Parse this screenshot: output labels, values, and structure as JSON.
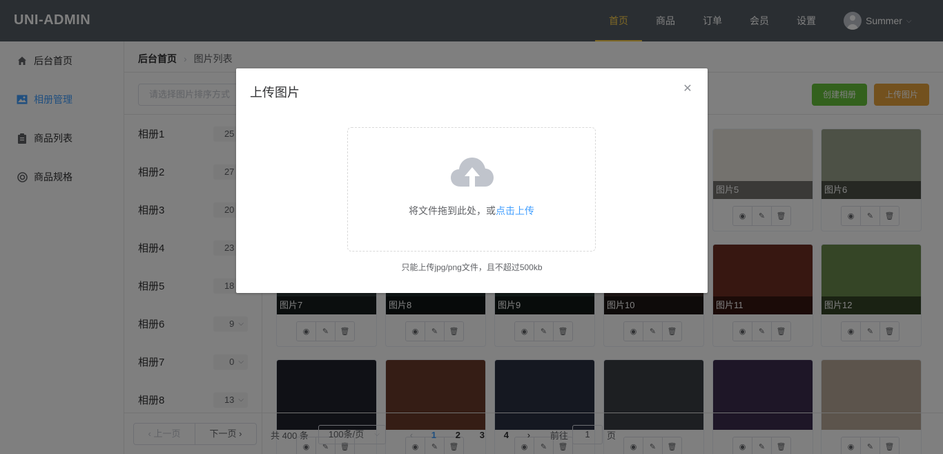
{
  "app": {
    "logo": "UNI-ADMIN"
  },
  "topnav": [
    {
      "label": "首页",
      "active": true
    },
    {
      "label": "商品",
      "active": false
    },
    {
      "label": "订单",
      "active": false
    },
    {
      "label": "会员",
      "active": false
    },
    {
      "label": "设置",
      "active": false
    }
  ],
  "user": {
    "name": "Summer"
  },
  "sidebar": [
    {
      "label": "后台首页",
      "icon": "home-icon",
      "active": false
    },
    {
      "label": "相册管理",
      "icon": "picture-icon",
      "active": true
    },
    {
      "label": "商品列表",
      "icon": "clipboard-icon",
      "active": false
    },
    {
      "label": "商品规格",
      "icon": "lifebuoy-icon",
      "active": false
    }
  ],
  "breadcrumb": {
    "root": "后台首页",
    "current": "图片列表"
  },
  "toolbar": {
    "sort_placeholder": "请选择图片排序方式",
    "create_label": "创建相册",
    "upload_label": "上传图片"
  },
  "albums": [
    {
      "name": "相册1",
      "count": "25"
    },
    {
      "name": "相册2",
      "count": "27"
    },
    {
      "name": "相册3",
      "count": "20"
    },
    {
      "name": "相册4",
      "count": "23"
    },
    {
      "name": "相册5",
      "count": "18"
    },
    {
      "name": "相册6",
      "count": "9"
    },
    {
      "name": "相册7",
      "count": "0"
    },
    {
      "name": "相册8",
      "count": "13"
    }
  ],
  "images": [
    {
      "title": "",
      "color": "#888"
    },
    {
      "title": "",
      "color": "#888"
    },
    {
      "title": "",
      "color": "#888"
    },
    {
      "title": "",
      "color": "#888"
    },
    {
      "title": "图片5",
      "color": "#e9e4dc"
    },
    {
      "title": "图片6",
      "color": "#9aa38d"
    },
    {
      "title": "图片7",
      "color": "#2f3a3a"
    },
    {
      "title": "图片8",
      "color": "#1f2a2a"
    },
    {
      "title": "图片9",
      "color": "#23332f"
    },
    {
      "title": "图片10",
      "color": "#3b2d2a"
    },
    {
      "title": "图片11",
      "color": "#6e2e22"
    },
    {
      "title": "图片12",
      "color": "#6a8a4d"
    },
    {
      "title": "",
      "color": "#20222c"
    },
    {
      "title": "",
      "color": "#6a3a2a"
    },
    {
      "title": "",
      "color": "#2a3142"
    },
    {
      "title": "",
      "color": "#3a3e44"
    },
    {
      "title": "",
      "color": "#3c2d4e"
    },
    {
      "title": "",
      "color": "#b8a898"
    }
  ],
  "pager": {
    "prev": "上一页",
    "next": "下一页",
    "total": "共 400 条",
    "page_size": "100条/页",
    "pages": [
      "1",
      "2",
      "3",
      "4"
    ],
    "goto_label": "前往",
    "goto_value": "1",
    "goto_suffix": "页"
  },
  "dialog": {
    "title": "上传图片",
    "drop_text": "将文件拖到此处，或",
    "drop_link": "点击上传",
    "tip": "只能上传jpg/png文件，且不超过500kb"
  }
}
